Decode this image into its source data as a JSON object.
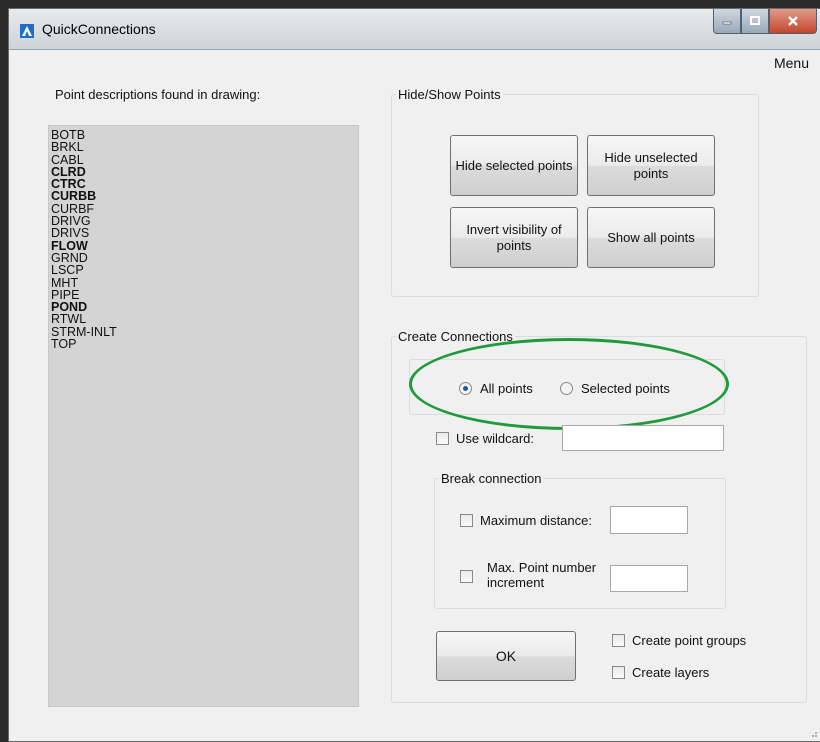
{
  "window": {
    "title": "QuickConnections"
  },
  "menubar": {
    "menu_label": "Menu"
  },
  "points_panel": {
    "label": "Point descriptions found in drawing:",
    "items": [
      {
        "text": "BOTB",
        "bold": false
      },
      {
        "text": "BRKL",
        "bold": false
      },
      {
        "text": "CABL",
        "bold": false
      },
      {
        "text": "CLRD",
        "bold": true
      },
      {
        "text": "CTRC",
        "bold": true
      },
      {
        "text": "CURBB",
        "bold": true
      },
      {
        "text": "CURBF",
        "bold": false
      },
      {
        "text": "DRIVG",
        "bold": false
      },
      {
        "text": "DRIVS",
        "bold": false
      },
      {
        "text": "FLOW",
        "bold": true
      },
      {
        "text": "GRND",
        "bold": false
      },
      {
        "text": "LSCP",
        "bold": false
      },
      {
        "text": "MHT",
        "bold": false
      },
      {
        "text": "PIPE",
        "bold": false
      },
      {
        "text": "POND",
        "bold": true
      },
      {
        "text": "RTWL",
        "bold": false
      },
      {
        "text": "STRM-INLT",
        "bold": false
      },
      {
        "text": "TOP",
        "bold": false
      }
    ]
  },
  "hide_show": {
    "legend": "Hide/Show Points",
    "hide_selected": "Hide selected points",
    "hide_unselected": "Hide unselected points",
    "invert_visibility": "Invert visibility of points",
    "show_all": "Show all points"
  },
  "create_connections": {
    "legend": "Create Connections",
    "all_points_label": "All points",
    "all_points_checked": true,
    "selected_points_label": "Selected points",
    "selected_points_checked": false,
    "use_wildcard_label": "Use wildcard:",
    "use_wildcard_checked": false,
    "wildcard_value": "",
    "break_connection": {
      "legend": "Break connection",
      "max_distance_label": "Maximum distance:",
      "max_distance_value": "",
      "max_increment_label": "Max. Point number increment",
      "max_increment_value": ""
    },
    "ok_label": "OK",
    "create_point_groups_label": "Create point groups",
    "create_layers_label": "Create layers"
  },
  "annotation": {
    "color": "#1f9a3c"
  },
  "icons": {
    "app": "app-logo-icon",
    "minimize": "minimize-icon",
    "maximize": "maximize-icon",
    "close": "close-icon"
  }
}
